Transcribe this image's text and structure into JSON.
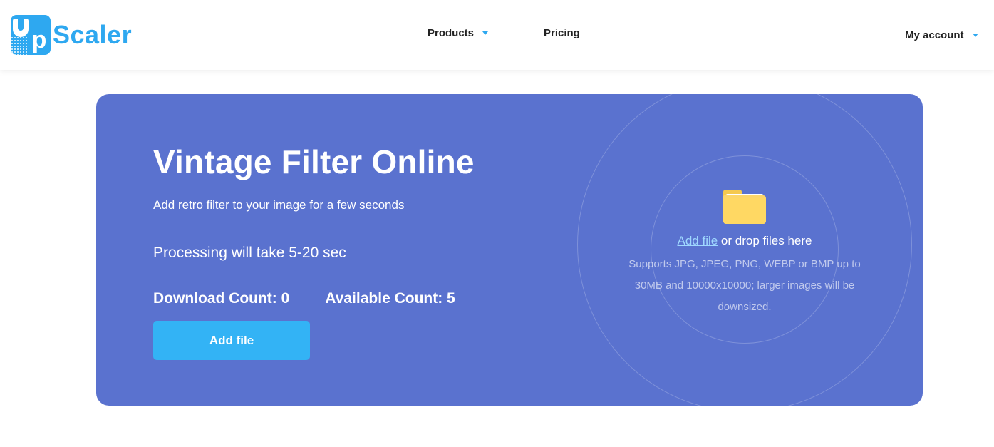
{
  "brand": {
    "logo_prefix": "up",
    "name": "Scaler",
    "accent_color": "#2ea8f0"
  },
  "nav": {
    "products": "Products",
    "pricing": "Pricing",
    "account": "My account"
  },
  "hero": {
    "background_color": "#5a72cf",
    "title": "Vintage Filter Online",
    "subtitle": "Add retro filter to your image for a few seconds",
    "processing": "Processing will take 5-20 sec",
    "download_count": "Download Count: 0",
    "available_count": "Available Count: 5",
    "add_button": "Add file"
  },
  "dropzone": {
    "icon": "folder-icon",
    "link_text": "Add file",
    "text": " or drop files here",
    "hint": "Supports JPG, JPEG, PNG, WEBP or BMP up to 30MB and 10000x10000; larger images will be downsized."
  }
}
